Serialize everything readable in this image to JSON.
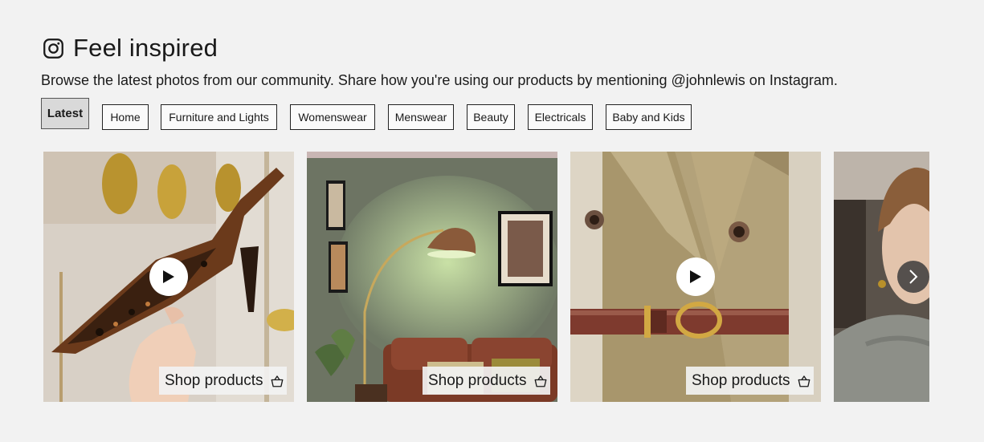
{
  "header": {
    "title": "Feel inspired",
    "icon": "instagram-icon",
    "subtitle": "Browse the latest photos from our community. Share how you're using our products by mentioning @johnlewis on Instagram."
  },
  "filters": {
    "active": "Latest",
    "items": [
      "Latest",
      "Home",
      "Furniture and Lights",
      "Womenswear",
      "Menswear",
      "Beauty",
      "Electricals",
      "Baby and Kids"
    ]
  },
  "carousel": {
    "shop_label": "Shop products",
    "next_icon": "chevron-right-icon",
    "cards": [
      {
        "video": true,
        "shop": true,
        "subject": "leopard-print-slingback-shoe"
      },
      {
        "video": false,
        "shop": true,
        "subject": "arc-floor-lamp-living-room"
      },
      {
        "video": true,
        "shop": true,
        "subject": "camel-coat-with-croc-belt"
      },
      {
        "video": false,
        "shop": false,
        "subject": "woman-in-grey-knit"
      }
    ]
  },
  "colors": {
    "background": "#f2f2f2",
    "active_chip": "#d9d9d9",
    "text": "#1a1a1a"
  }
}
